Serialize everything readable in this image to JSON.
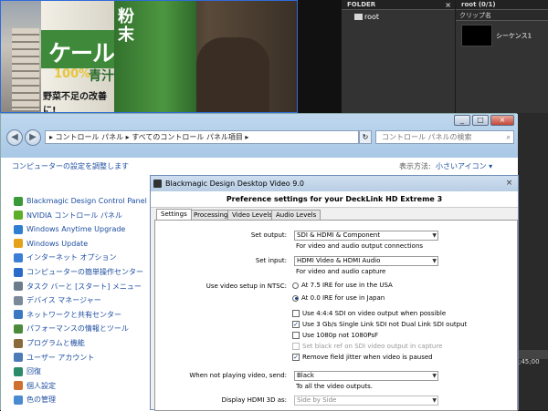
{
  "preview": {
    "carton_text": "ケール",
    "carton_side": "粉末",
    "carton_badge": "100%",
    "carton_label": "青汁",
    "carton_bottom": "野菜不足の改善に!"
  },
  "folder_panel": {
    "title": "FOLDER",
    "close": "×",
    "root_item": "root"
  },
  "clip_panel": {
    "title": "root (0/1)",
    "column": "クリップ名",
    "clip_name": "シーケンス1"
  },
  "explorer": {
    "caption_buttons": [
      "_",
      "□",
      "×"
    ],
    "address": "▸  コントロール パネル  ▸  すべてのコントロール パネル項目  ▸",
    "refresh": "↻",
    "search_placeholder": "コントロール パネルの検索",
    "adjust_link": "コンピューターの設定を調整します",
    "view_label": "表示方法:",
    "view_value": "小さいアイコン ▾",
    "items": [
      {
        "label": "Blackmagic Design Control Panel",
        "color": "#3a9a3a"
      },
      {
        "label": "NVIDIA コントロール パネル",
        "color": "#5fae2a"
      },
      {
        "label": "Windows Anytime Upgrade",
        "color": "#2f7fd0"
      },
      {
        "label": "Windows Update",
        "color": "#e3a21a"
      },
      {
        "label": "インターネット オプション",
        "color": "#3a7fd5"
      },
      {
        "label": "コンピューターの簡単操作センター",
        "color": "#2a6ac8"
      },
      {
        "label": "タスク バーと [スタート] メニュー",
        "color": "#6b7c8c"
      },
      {
        "label": "デバイス マネージャー",
        "color": "#7a8a9a"
      },
      {
        "label": "ネットワークと共有センター",
        "color": "#3b78c2"
      },
      {
        "label": "パフォーマンスの情報とツール",
        "color": "#4a8a3a"
      },
      {
        "label": "プログラムと機能",
        "color": "#8a6a3a"
      },
      {
        "label": "ユーザー アカウント",
        "color": "#4a7ab8"
      },
      {
        "label": "回復",
        "color": "#2b8a6a"
      },
      {
        "label": "個人設定",
        "color": "#d07030"
      },
      {
        "label": "色の管理",
        "color": "#4a8ad0"
      }
    ]
  },
  "timeline": {
    "time": ";45;00"
  },
  "dialog": {
    "title": "Blackmagic Design Desktop Video 9.0",
    "close": "×",
    "header": "Preference settings for your DeckLink HD Extreme 3",
    "tabs": [
      "Settings",
      "Processing",
      "Video Levels",
      "Audio Levels"
    ],
    "active_tab": "Settings",
    "set_output_label": "Set output:",
    "set_output_value": "SDI & HDMI & Component",
    "set_output_sub": "For video and audio output connections",
    "set_input_label": "Set input:",
    "set_input_value": "HDMI Video & HDMI Audio",
    "set_input_sub": "For video and audio capture",
    "ntsc_label": "Use video setup in NTSC:",
    "ntsc_opt1": "At 7.5 IRE for use in the USA",
    "ntsc_opt2": "At 0.0 IRE for use in Japan",
    "ntsc_selected": 2,
    "check1": "Use 4:4:4 SDI on video output when possible",
    "check2": "Use 3 Gb/s Single Link SDI not Dual Link SDI output",
    "check3": "Use 1080p not 1080PsF",
    "check4": "Set black ref on SDI video output in capture",
    "check5": "Remove field jitter when video is paused",
    "checked": [
      false,
      true,
      false,
      false,
      true
    ],
    "disabled": [
      false,
      false,
      false,
      true,
      false
    ],
    "not_playing_label": "When not playing video, send:",
    "not_playing_value": "Black",
    "not_playing_sub": "To all the video outputs.",
    "hdmi3d_label": "Display HDMI 3D as:",
    "hdmi3d_value": "Side by Side"
  }
}
